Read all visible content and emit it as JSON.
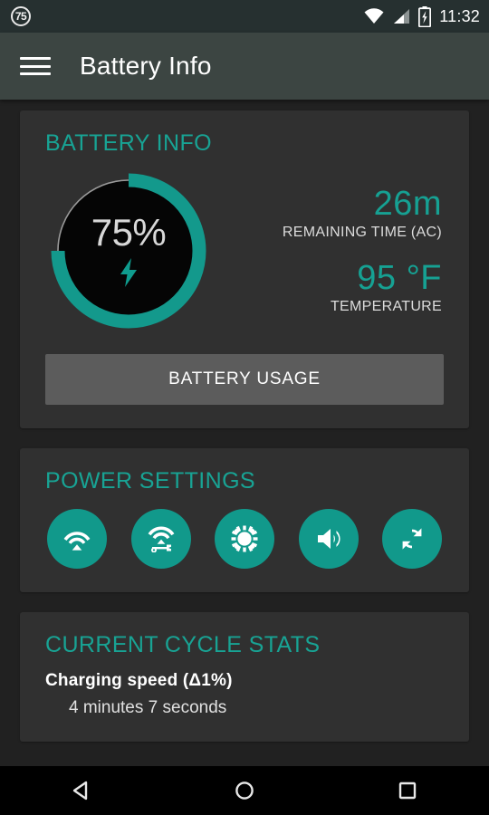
{
  "statusbar": {
    "notification_badge": "75",
    "time": "11:32",
    "icons": [
      "wifi-icon",
      "cell-signal-icon",
      "battery-charging-icon"
    ]
  },
  "appbar": {
    "menu_icon": "hamburger-menu-icon",
    "title": "Battery Info"
  },
  "battery_info": {
    "title": "BATTERY INFO",
    "percent_label": "75%",
    "percent_value": 75,
    "charging_icon": "lightning-bolt-icon",
    "stats": [
      {
        "value": "26m",
        "label": "REMAINING TIME (AC)"
      },
      {
        "value": "95 °F",
        "label": "TEMPERATURE"
      }
    ],
    "usage_button": "BATTERY USAGE"
  },
  "power_settings": {
    "title": "POWER SETTINGS",
    "toggles": [
      {
        "name": "wifi-toggle",
        "icon": "wifi-icon"
      },
      {
        "name": "wifi-settings-toggle",
        "icon": "wifi-wrench-icon"
      },
      {
        "name": "brightness-toggle",
        "icon": "brightness-sun-icon"
      },
      {
        "name": "volume-toggle",
        "icon": "volume-up-icon"
      },
      {
        "name": "sync-toggle",
        "icon": "sync-refresh-icon"
      }
    ]
  },
  "cycle_stats": {
    "title": "CURRENT CYCLE STATS",
    "entries": [
      {
        "title": "Charging speed (Δ1%)",
        "value": "4 minutes 7 seconds"
      }
    ]
  },
  "navbar": {
    "back": "back-triangle-icon",
    "home": "home-circle-icon",
    "recents": "recents-square-icon"
  },
  "colors": {
    "accent": "#16a193",
    "toggle": "#11998b",
    "card": "#303030",
    "background": "#212121",
    "appbar": "#3c4542",
    "statusbar": "#263030"
  }
}
